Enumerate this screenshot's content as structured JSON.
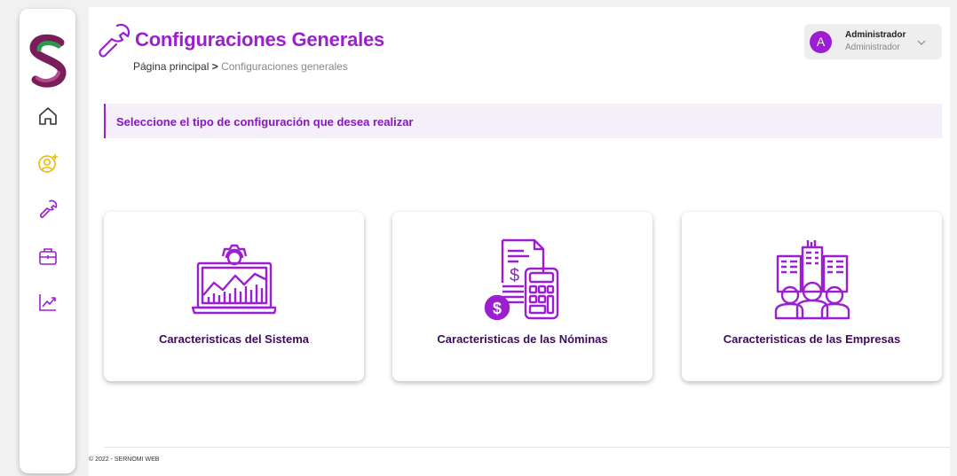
{
  "app": {
    "logo": "sernomi-s-logo"
  },
  "sidebar": {
    "items": [
      {
        "id": "home",
        "icon": "home-icon"
      },
      {
        "id": "users",
        "icon": "add-user-icon"
      },
      {
        "id": "settings",
        "icon": "wrench-icon"
      },
      {
        "id": "companies",
        "icon": "briefcase-icon"
      },
      {
        "id": "reports",
        "icon": "trend-chart-icon"
      }
    ],
    "accent_colors": {
      "users": "#f2b705",
      "default": "#9b1fd1"
    }
  },
  "header": {
    "title": "Configuraciones Generales",
    "title_icon": "wrench-icon",
    "breadcrumb": {
      "home": "Página principal",
      "separator": ">",
      "current": "Configuraciones generales"
    }
  },
  "user": {
    "avatar_letter": "A",
    "name": "Administrador",
    "role": "Administrador"
  },
  "notice": {
    "text": "Seleccione el tipo de configuración que desea realizar"
  },
  "cards": [
    {
      "label": "Caracteristicas del Sistema",
      "icon": "system-settings-icon"
    },
    {
      "label": "Caracteristicas de las Nóminas",
      "icon": "payroll-calculator-icon"
    },
    {
      "label": "Caracteristicas de las Empresas",
      "icon": "companies-building-icon"
    }
  ],
  "footer": {
    "text": "© 2022 - SERNOMI WEB"
  },
  "colors": {
    "accent": "#9b1fd1",
    "accent_dark": "#3d0b5e",
    "notice_bg": "#f5effa",
    "page_bg": "#f1f1f1"
  }
}
